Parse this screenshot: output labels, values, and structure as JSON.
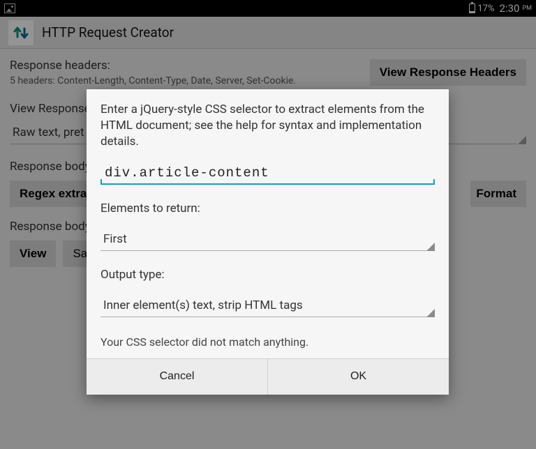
{
  "status": {
    "battery_pct": "17%",
    "time": "2:30",
    "ampm": "PM",
    "battery_fill_pct": 17
  },
  "actionbar": {
    "title": "HTTP Request Creator"
  },
  "page": {
    "resp_headers_label": "Response headers:",
    "resp_headers_summary": "5 headers: Content-Length, Content-Type, Date, Server, Set-Cookie.",
    "view_response_headers": "View Response Headers",
    "view_response_label": "View Response",
    "view_spinner_value": "Raw text, pret",
    "body_structured_label": "Response body",
    "regex_btn": "Regex extrac",
    "format_btn": "Format",
    "body_label2": "Response body",
    "view_btn": "View",
    "save_btn": "Sav"
  },
  "dialog": {
    "prompt": "Enter a jQuery-style CSS selector to extract elements from the HTML document; see the help for syntax and implementation details.",
    "input_value": "div.article-content",
    "elements_label": "Elements to return:",
    "elements_value": "First",
    "output_label": "Output type:",
    "output_value": "Inner element(s) text, strip HTML tags",
    "status": "Your CSS selector did not match anything.",
    "cancel": "Cancel",
    "ok": "OK"
  }
}
